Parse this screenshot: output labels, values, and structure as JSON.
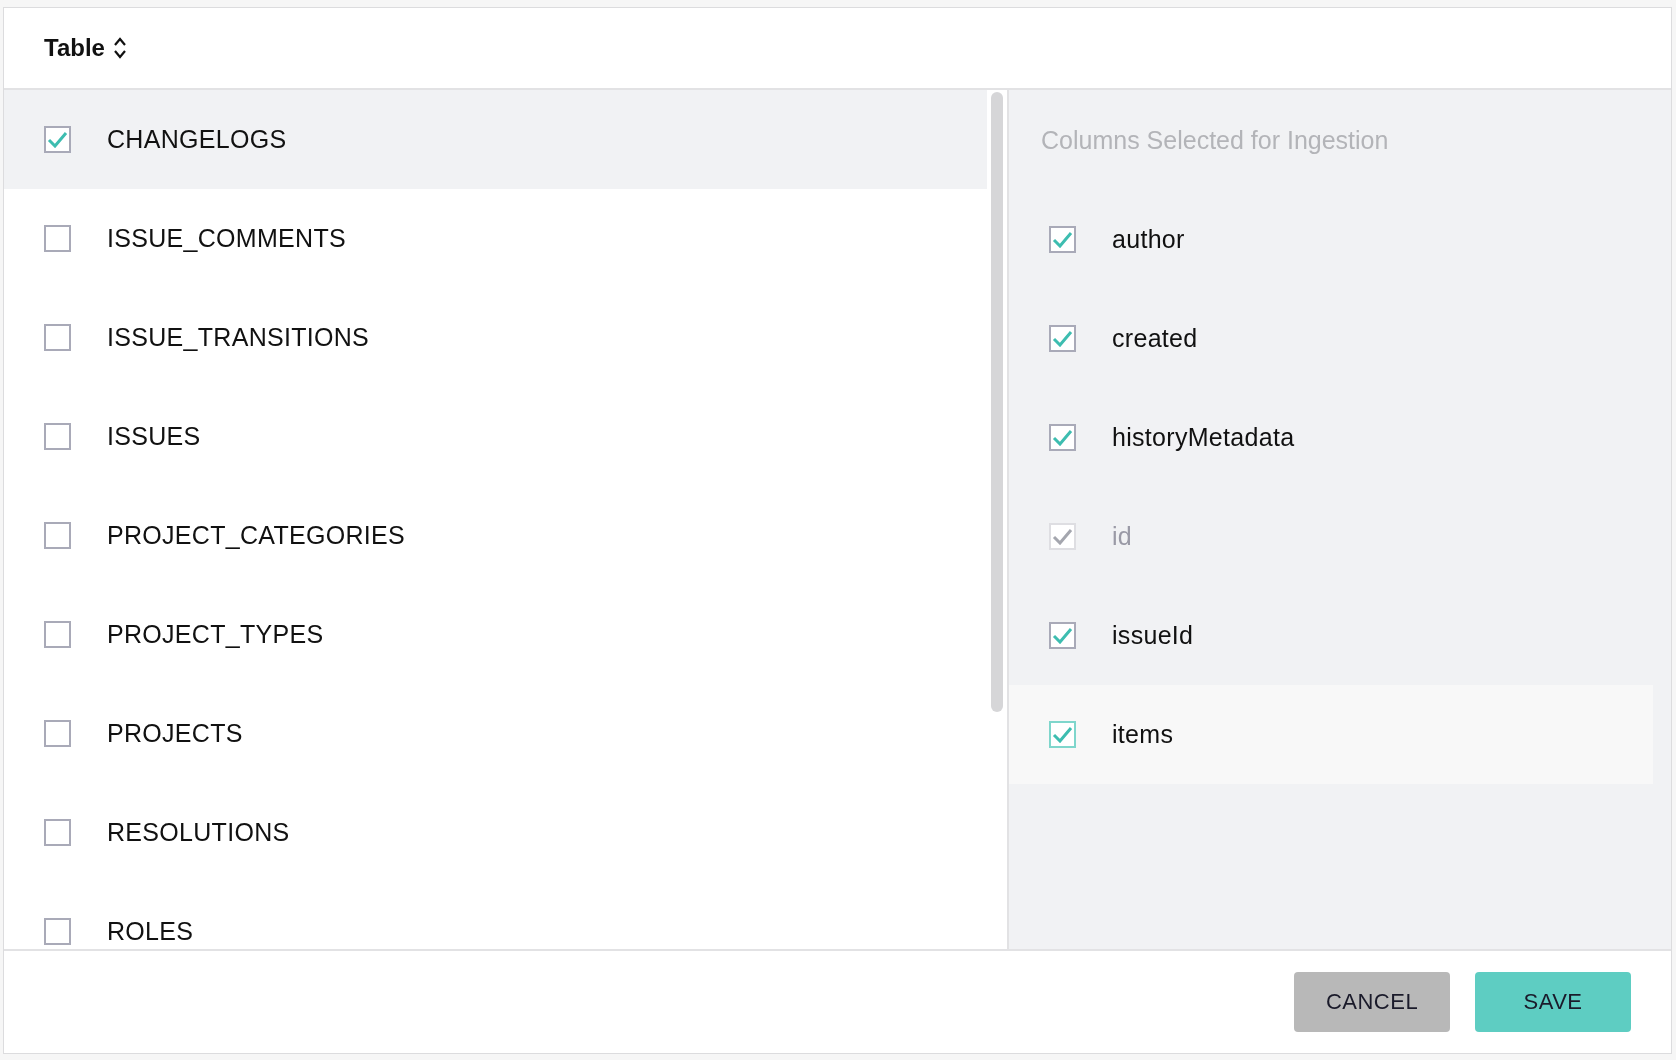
{
  "header": {
    "title": "Table"
  },
  "tables": [
    {
      "name": "CHANGELOGS",
      "checked": true,
      "selected": true
    },
    {
      "name": "ISSUE_COMMENTS",
      "checked": false,
      "selected": false
    },
    {
      "name": "ISSUE_TRANSITIONS",
      "checked": false,
      "selected": false
    },
    {
      "name": "ISSUES",
      "checked": false,
      "selected": false
    },
    {
      "name": "PROJECT_CATEGORIES",
      "checked": false,
      "selected": false
    },
    {
      "name": "PROJECT_TYPES",
      "checked": false,
      "selected": false
    },
    {
      "name": "PROJECTS",
      "checked": false,
      "selected": false
    },
    {
      "name": "RESOLUTIONS",
      "checked": false,
      "selected": false
    },
    {
      "name": "ROLES",
      "checked": false,
      "selected": false
    }
  ],
  "columns_panel": {
    "title": "Columns Selected for Ingestion",
    "columns": [
      {
        "name": "author",
        "checked": true,
        "disabled": false,
        "hovered": false
      },
      {
        "name": "created",
        "checked": true,
        "disabled": false,
        "hovered": false
      },
      {
        "name": "historyMetadata",
        "checked": true,
        "disabled": false,
        "hovered": false
      },
      {
        "name": "id",
        "checked": true,
        "disabled": true,
        "hovered": false
      },
      {
        "name": "issueId",
        "checked": true,
        "disabled": false,
        "hovered": false
      },
      {
        "name": "items",
        "checked": true,
        "disabled": false,
        "hovered": true
      }
    ]
  },
  "buttons": [
    {
      "label": "CANCEL",
      "kind": "secondary"
    },
    {
      "label": "SAVE",
      "kind": "primary"
    }
  ]
}
